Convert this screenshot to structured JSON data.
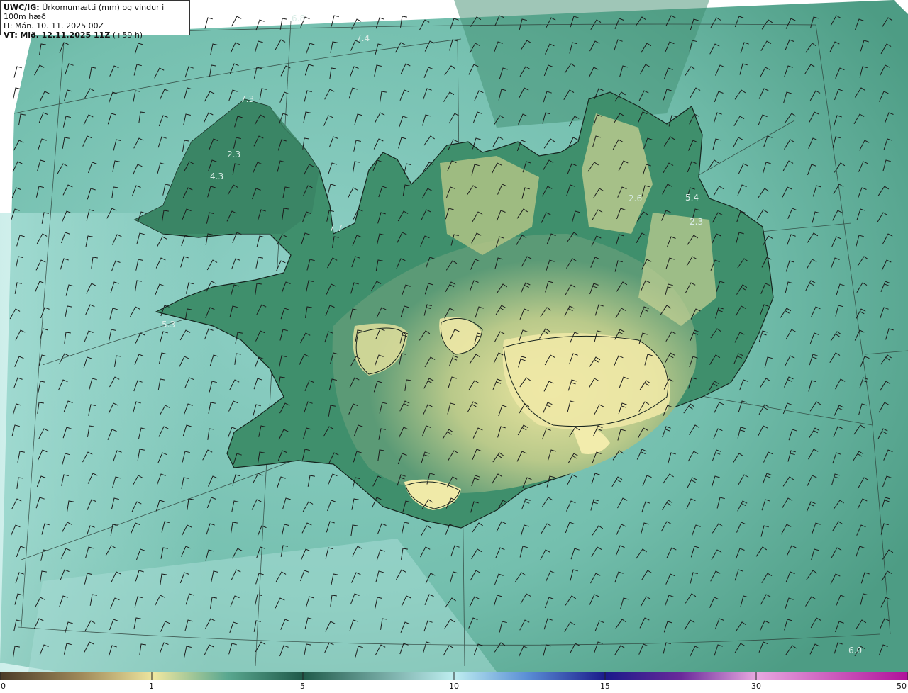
{
  "header": {
    "model": "UWC/IG:",
    "title": "Úrkomumætti (mm) og vindur i 100m hæð",
    "it_prefix": "IT:",
    "it_value": "Mán. 10. 11. 2025 00Z",
    "vt_prefix": "VT:",
    "vt_value": "Mið. 12.11.2025 11Z",
    "vt_lead": "(+59 h)"
  },
  "point_values": [
    "6.8",
    "7.4",
    "7.3",
    "2.3",
    "4.3",
    "7.7",
    "5.3",
    "2.6",
    "5.4",
    "2.3",
    "6.0"
  ],
  "colorbar": {
    "ticks": [
      "0",
      "1",
      "5",
      "10",
      "15",
      "30",
      "50"
    ],
    "colors": [
      "#4a3b28",
      "#a08a5a",
      "#efe7a0",
      "#5aa890",
      "#1f5a4a",
      "#bfeef0",
      "#5b8fd6",
      "#1a1a8a",
      "#6a2a9a",
      "#e8a8e0",
      "#b0109a"
    ]
  },
  "colors": {
    "sea_light": "#a9e0da",
    "sea_mid": "#6fb8a8",
    "land_green": "#3f8a6a",
    "land_yellow": "#e6e39a",
    "coast": "#1a2a22"
  }
}
